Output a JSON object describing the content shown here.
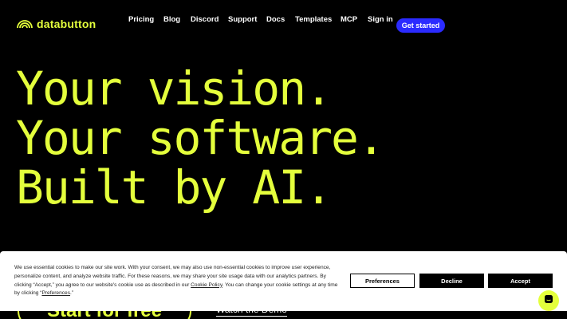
{
  "brand": {
    "name": "databutton",
    "accent_color": "#e4ff3c",
    "logo_icon": "rainbow-arcs-icon"
  },
  "nav": {
    "links": [
      "Pricing",
      "Blog",
      "Discord",
      "Support",
      "Docs",
      "Templates",
      "MCP",
      "Sign in"
    ],
    "cta_label": "Get started",
    "cta_color": "#2b2bff"
  },
  "hero": {
    "line1": "Your vision.",
    "line2": "Your software.",
    "line3": "Built by AI."
  },
  "actions": {
    "start_label": "Start for free",
    "demo_label": "Watch the Demo"
  },
  "cookie_banner": {
    "text_part1": "We use essential cookies to make our site work. With your consent, we may also use non-essential cookies to improve user experience, personalize content, and analyze website traffic. For these reasons, we may share your site usage data with our analytics partners. By clicking “Accept,” you agree to our website's cookie use as described in our ",
    "policy_link": "Cookie Policy",
    "text_part2": ". You can change your cookie settings at any time by clicking “",
    "pref_link": "Preferences",
    "text_part3": ".”",
    "preferences_label": "Preferences",
    "decline_label": "Decline",
    "accept_label": "Accept"
  },
  "chat": {
    "icon": "chat-icon"
  }
}
